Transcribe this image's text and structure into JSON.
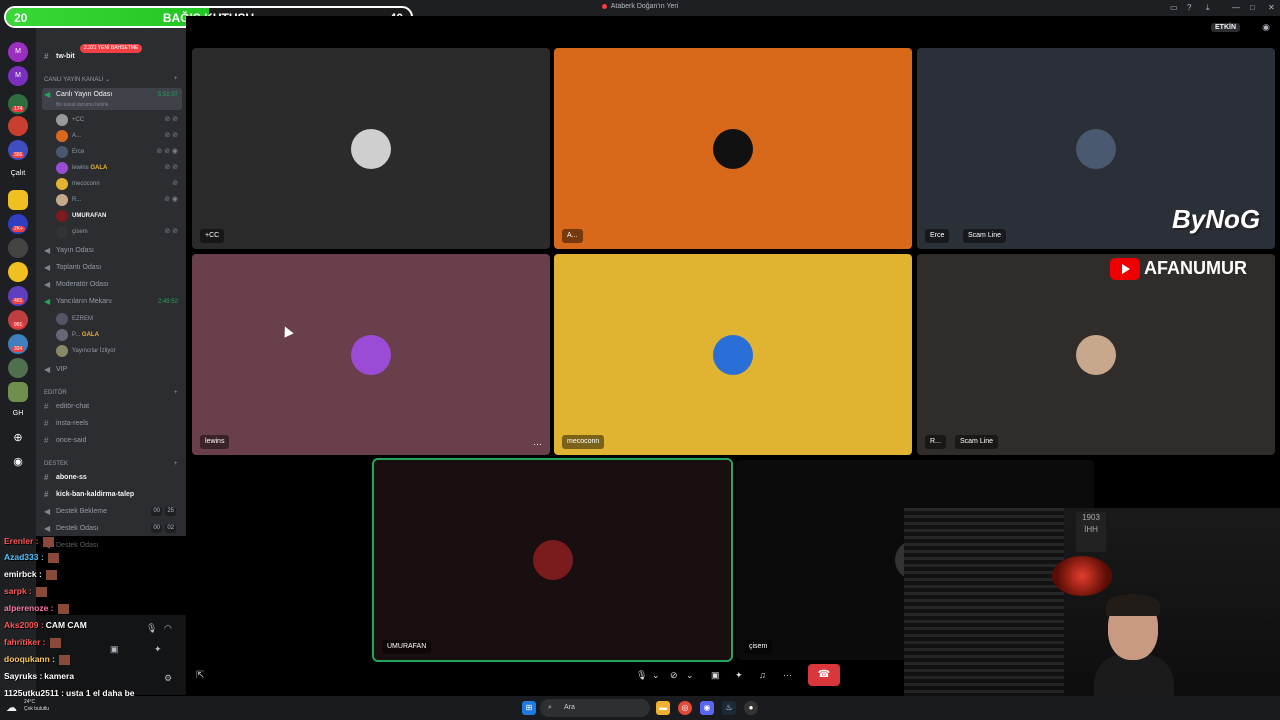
{
  "window": {
    "title": "Ataberk Doğan'ın Yeri"
  },
  "alert": {
    "left_count": "20",
    "label": "BAĞIŞ KUTUSU",
    "right_count": "40",
    "progress": 0.5,
    "sub": "Canlı Yayın Odası"
  },
  "rail": {
    "items": [
      "M",
      "M",
      "Çalıt",
      "GH"
    ],
    "badges": [
      "174",
      "366",
      "2K+",
      "461",
      "991",
      "334"
    ]
  },
  "channels": {
    "top_item": "tw-bit",
    "live_pill": "2.321 YENİ BAHSETME",
    "category_live": "CANLI YAYIN KANALI",
    "live_room": {
      "label": "Canlı Yayın Odası",
      "status": "Bir kanal durumu belirle",
      "timer": "5:51:07"
    },
    "live_users": [
      {
        "name": "+CC"
      },
      {
        "name": "A..."
      },
      {
        "name": "Erce"
      },
      {
        "name": "lewins",
        "tag": "GALA"
      },
      {
        "name": "mecoconn"
      },
      {
        "name": "R..."
      },
      {
        "name": "UMURAFAN"
      },
      {
        "name": "çisem"
      }
    ],
    "rooms": [
      "Yayın Odası",
      "Toplantı Odası",
      "Moderatör Odası"
    ],
    "guest_room": {
      "label": "Yancıların Mekanı",
      "timer": "2:49:52"
    },
    "guest_users": [
      {
        "name": "EZREM"
      },
      {
        "name": "P...",
        "tag": "GALA"
      },
      {
        "name": "Yayıncılar İzliyor"
      }
    ],
    "vip": "VIP",
    "category_editor": "Editör",
    "editor_channels": [
      "editör-chat",
      "insta-reels",
      "once-said"
    ],
    "category_support": "Destek",
    "support_channels": [
      "abone-ss",
      "kick-ban-kaldirma-talep"
    ],
    "support_voice": [
      {
        "label": "Destek Bekleme",
        "c1": "00",
        "c2": "25"
      },
      {
        "label": "Destek Odası",
        "c1": "00",
        "c2": "02"
      },
      {
        "label": "Destek Odası"
      }
    ]
  },
  "chat": {
    "messages": [
      {
        "user": "Erenler :",
        "text": "",
        "color": "#ff5555"
      },
      {
        "user": "Azad333 :",
        "text": "",
        "color": "#4fc3ff"
      },
      {
        "user": "emirbck :",
        "text": "",
        "color": "#ffffff"
      },
      {
        "user": "sarpk :",
        "text": "",
        "color": "#ff5555"
      },
      {
        "user": "alperenoze :",
        "text": "",
        "color": "#ff77aa"
      },
      {
        "user": "Aks2009 :",
        "text": "CAM CAM",
        "color": "#ff5555"
      },
      {
        "user": "fahritiker :",
        "text": "",
        "color": "#ff5555"
      },
      {
        "user": "dooqukann :",
        "text": "",
        "color": "#ffc857"
      },
      {
        "user": "Sayruks :",
        "text": "kamera",
        "color": "#ffffff"
      },
      {
        "user": "1125utku2511 :",
        "text": "usta 1 el daha be",
        "color": "#ffffff"
      }
    ]
  },
  "stage": {
    "etkin": "ETKİN",
    "tiles": [
      {
        "name": "+CC",
        "extra": "",
        "color": "#2b2b2b",
        "avatar": "#cfcfcf"
      },
      {
        "name": "A...",
        "extra": "",
        "color": "#d9691a",
        "avatar": "#111111"
      },
      {
        "name": "Erce",
        "extra": "Scam Line",
        "color": "#2b2f38",
        "avatar": "#4a5870"
      },
      {
        "name": "lewins",
        "extra": "",
        "color": "#6a3f4c",
        "avatar": "#9b4cd6"
      },
      {
        "name": "mecoconn",
        "extra": "",
        "color": "#e0b330",
        "avatar": "#2a6fd8"
      },
      {
        "name": "R...",
        "extra": "Scam Line",
        "color": "#2f2c29",
        "avatar": "#c8a88c"
      },
      {
        "name": "UMURAFAN",
        "extra": "",
        "color": "#1a0f10",
        "avatar": "#7a1b1e"
      },
      {
        "name": "çisem",
        "extra": "",
        "color": "#0b0b0b",
        "avatar": "#333333"
      }
    ],
    "brand1": "ByNoG",
    "brand2": "AFANUMUR"
  },
  "cam": {
    "sign": "1903 İHH"
  },
  "taskbar": {
    "weather_temp": "24°C",
    "weather_text": "Çok bulutlu",
    "search": "Ara"
  }
}
